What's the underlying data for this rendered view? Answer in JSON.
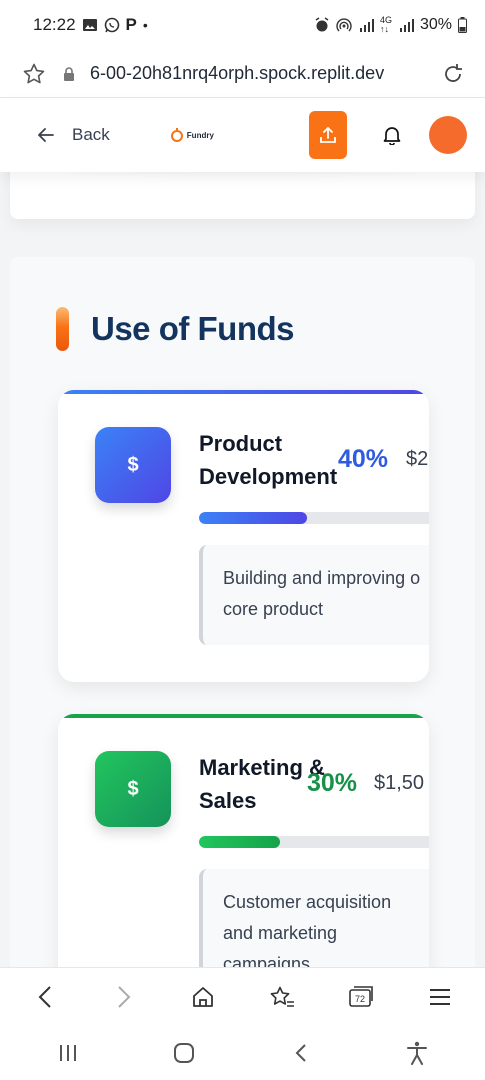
{
  "status_bar": {
    "time": "12:22",
    "left_icons": [
      "image-icon",
      "whatsapp-icon",
      "p-icon",
      "dot-icon"
    ],
    "right_icons": [
      "alarm-icon",
      "hotspot-icon",
      "signal-icon",
      "4g-icon",
      "signal-icon-2"
    ],
    "battery": "30%"
  },
  "browser": {
    "url": "6-00-20h81nrq4orph.spock.replit.dev"
  },
  "header": {
    "back_label": "Back",
    "logo_text": "Fundry",
    "accent_color": "#f97316"
  },
  "section": {
    "title": "Use of Funds"
  },
  "funds": [
    {
      "icon_symbol": "$",
      "name": "Product Development",
      "percent": "40%",
      "percent_value": 0.4,
      "amount": "$2",
      "description_line1": "Building and improving o",
      "description_line2": "core product",
      "color": "#4f5fe6"
    },
    {
      "icon_symbol": "$",
      "name": "Marketing & Sales",
      "percent": "30%",
      "percent_value": 0.3,
      "amount": "$1,50",
      "description_line1": "Customer acquisition",
      "description_line2": "and marketing",
      "description_line3": "campaigns",
      "color": "#16a34a"
    }
  ],
  "browser_nav": {
    "tabs_count": "72",
    "items": [
      "back-icon",
      "forward-icon",
      "home-icon",
      "bookmark-add-icon",
      "tabs-icon",
      "menu-icon"
    ]
  },
  "system_nav": {
    "items": [
      "recents-icon",
      "home-button-icon",
      "back-nav-icon",
      "accessibility-icon"
    ]
  }
}
